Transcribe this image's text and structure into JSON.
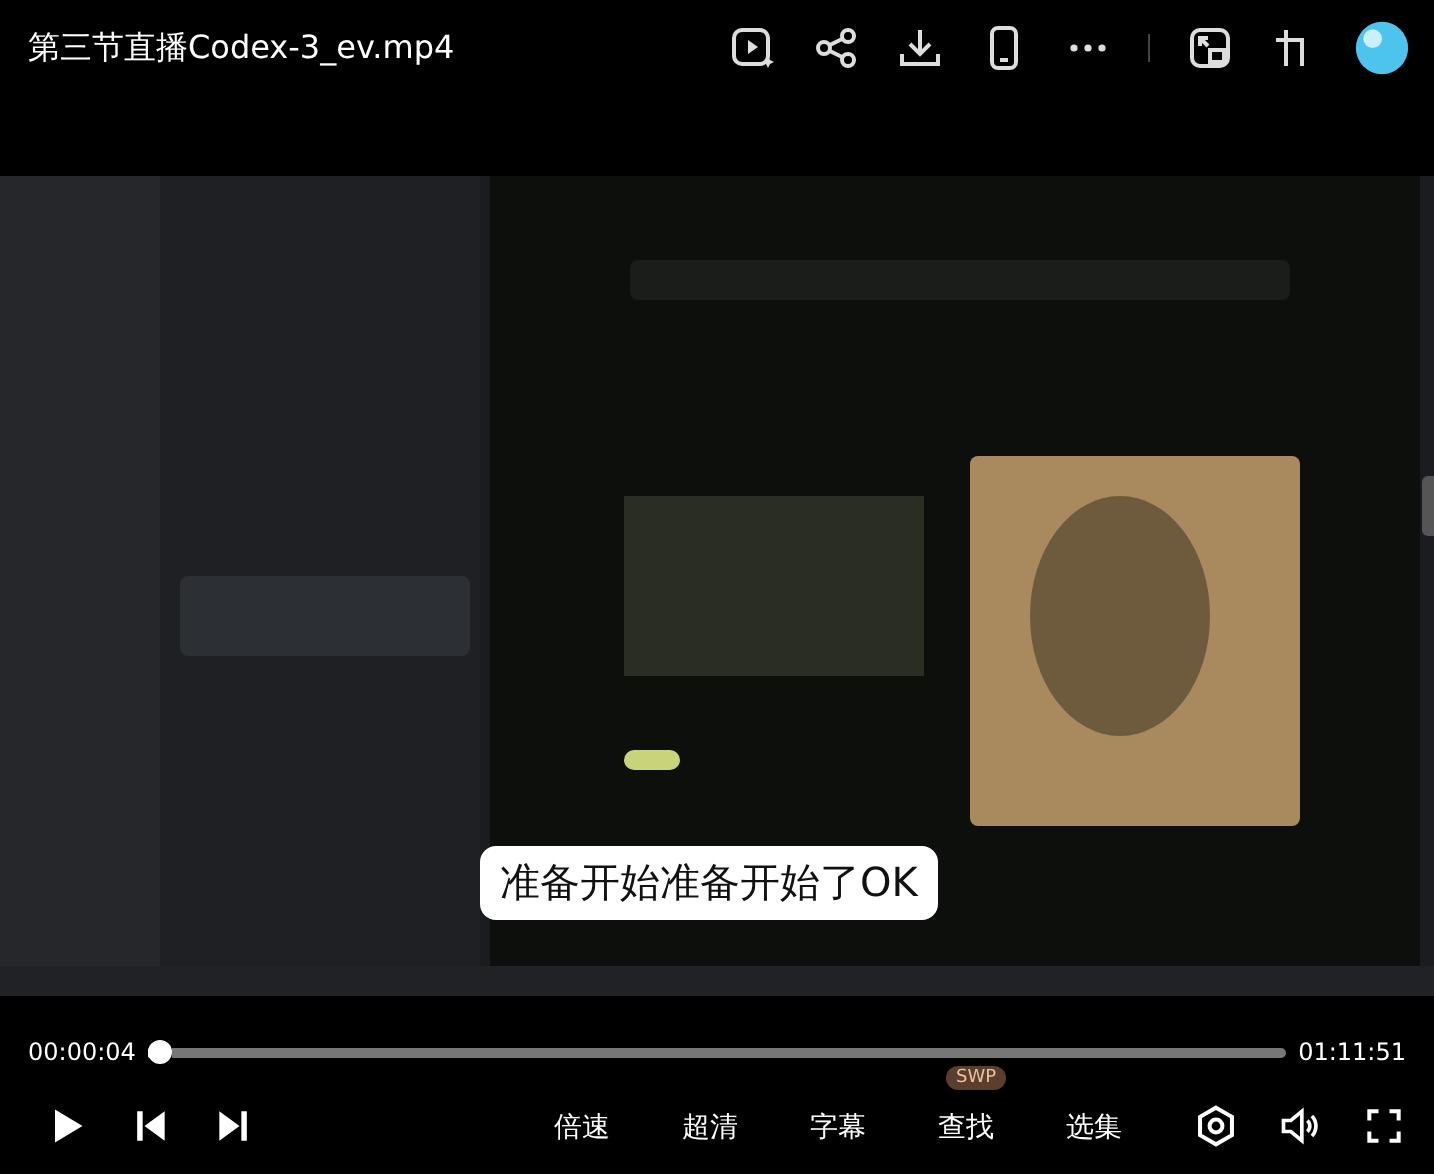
{
  "title": "第三节直播Codex-3_ev.mp4",
  "video": {
    "subtitle": "准备开始准备开始了OK"
  },
  "progress": {
    "elapsed": "00:00:04",
    "total": "01:11:51",
    "level": 0.001
  },
  "menu": [
    {
      "label": "倍速"
    },
    {
      "label": "超清"
    },
    {
      "label": "字幕"
    },
    {
      "label": "查找",
      "badge": "SWP"
    },
    {
      "label": "选集"
    }
  ]
}
